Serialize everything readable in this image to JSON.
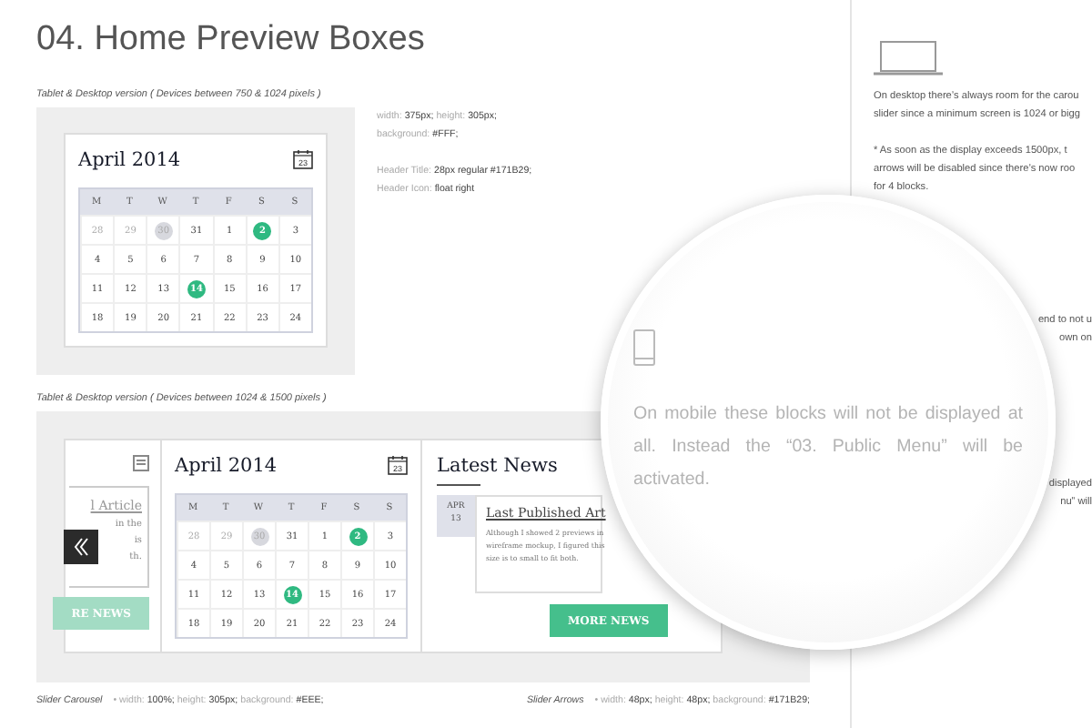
{
  "page_title": "04. Home Preview Boxes",
  "tablet": {
    "caption": "Tablet & Desktop version ( Devices between 750 & 1024 pixels )",
    "calendar": {
      "month": "April 2014",
      "icon_day": "23",
      "weekdays": [
        "M",
        "T",
        "W",
        "T",
        "F",
        "S",
        "S"
      ],
      "weeks": [
        [
          {
            "d": "28",
            "kind": "outside"
          },
          {
            "d": "29",
            "kind": "outside"
          },
          {
            "d": "30",
            "kind": "past"
          },
          {
            "d": "31",
            "kind": "day"
          },
          {
            "d": "1",
            "kind": "day"
          },
          {
            "d": "2",
            "kind": "event"
          },
          {
            "d": "3",
            "kind": "day"
          }
        ],
        [
          {
            "d": "4",
            "kind": "day"
          },
          {
            "d": "5",
            "kind": "day"
          },
          {
            "d": "6",
            "kind": "day"
          },
          {
            "d": "7",
            "kind": "day"
          },
          {
            "d": "8",
            "kind": "day"
          },
          {
            "d": "9",
            "kind": "day"
          },
          {
            "d": "10",
            "kind": "day"
          }
        ],
        [
          {
            "d": "11",
            "kind": "day"
          },
          {
            "d": "12",
            "kind": "day"
          },
          {
            "d": "13",
            "kind": "day"
          },
          {
            "d": "14",
            "kind": "event"
          },
          {
            "d": "15",
            "kind": "day"
          },
          {
            "d": "16",
            "kind": "day"
          },
          {
            "d": "17",
            "kind": "day"
          }
        ],
        [
          {
            "d": "18",
            "kind": "day"
          },
          {
            "d": "19",
            "kind": "day"
          },
          {
            "d": "20",
            "kind": "day"
          },
          {
            "d": "21",
            "kind": "day"
          },
          {
            "d": "22",
            "kind": "day"
          },
          {
            "d": "23",
            "kind": "day"
          },
          {
            "d": "24",
            "kind": "day"
          }
        ]
      ]
    },
    "spec_notes": [
      "width: **375px;** height: **305px;**",
      "background: **#FFF;**",
      "Header Title: **28px regular #171B29;**",
      "Header Icon: **float right**"
    ]
  },
  "desktop": {
    "caption": "Tablet & Desktop version ( Devices between 1024 & 1500 pixels )",
    "previous_card": {
      "heading": "l Article",
      "lines": [
        "in the",
        "is",
        "th."
      ],
      "button": "RE NEWS"
    },
    "calendar": {
      "month": "April 2014",
      "icon_day": "23",
      "weekdays": [
        "M",
        "T",
        "W",
        "T",
        "F",
        "S",
        "S"
      ],
      "weeks": [
        [
          {
            "d": "28",
            "kind": "outside"
          },
          {
            "d": "29",
            "kind": "outside"
          },
          {
            "d": "30",
            "kind": "past"
          },
          {
            "d": "31",
            "kind": "day"
          },
          {
            "d": "1",
            "kind": "day"
          },
          {
            "d": "2",
            "kind": "event"
          },
          {
            "d": "3",
            "kind": "day"
          }
        ],
        [
          {
            "d": "4",
            "kind": "day"
          },
          {
            "d": "5",
            "kind": "day"
          },
          {
            "d": "6",
            "kind": "day"
          },
          {
            "d": "7",
            "kind": "day"
          },
          {
            "d": "8",
            "kind": "day"
          },
          {
            "d": "9",
            "kind": "day"
          },
          {
            "d": "10",
            "kind": "day"
          }
        ],
        [
          {
            "d": "11",
            "kind": "day"
          },
          {
            "d": "12",
            "kind": "day"
          },
          {
            "d": "13",
            "kind": "day"
          },
          {
            "d": "14",
            "kind": "event"
          },
          {
            "d": "15",
            "kind": "day"
          },
          {
            "d": "16",
            "kind": "day"
          },
          {
            "d": "17",
            "kind": "day"
          }
        ],
        [
          {
            "d": "18",
            "kind": "day"
          },
          {
            "d": "19",
            "kind": "day"
          },
          {
            "d": "20",
            "kind": "day"
          },
          {
            "d": "21",
            "kind": "day"
          },
          {
            "d": "22",
            "kind": "day"
          },
          {
            "d": "23",
            "kind": "day"
          },
          {
            "d": "24",
            "kind": "day"
          }
        ]
      ]
    },
    "news": {
      "heading": "Latest News",
      "date_month": "APR",
      "date_day": "13",
      "article_title": "Last Published Art",
      "article_lines": [
        "Although I showed 2 previews in",
        "wireframe mockup, I figured this",
        "size is to small to fit both."
      ],
      "button": "MORE NEWS"
    },
    "footnotes": [
      {
        "name": "Slider Carousel",
        "spec": "• width: **100%;** height: **305px;** background: **#EEE;**"
      },
      {
        "name": "Slider Arrows",
        "spec": "• width: **48px;** height: **48px;** background: **#171B29;**"
      }
    ]
  },
  "notes": {
    "desktop_lines": [
      "On desktop there’s always room for the carou",
      "slider since a minimum screen is 1024 or bigg"
    ],
    "arrow_lines": [
      "* As soon as the display exceeds 1500px, t",
      "arrows will be disabled since there’s now roo",
      "for 4 blocks."
    ],
    "hidden_fragments_top": [
      "end to not u",
      "own on"
    ],
    "hidden_fragments_bottom": [
      "displayed",
      "nu” will"
    ]
  },
  "magnifier": {
    "text": "On mobile these blocks will not be displayed at all. Instead the “03. Public Menu” will be activated."
  }
}
